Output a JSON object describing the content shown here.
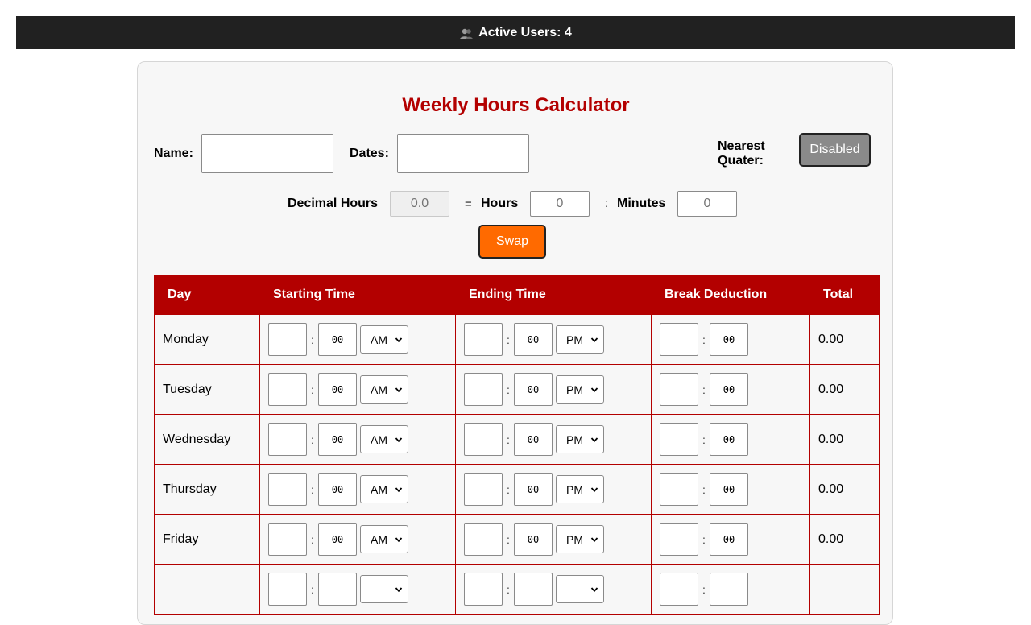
{
  "topbar": {
    "icon": "users-icon",
    "active_users_text": "Active Users: 4"
  },
  "calculator": {
    "title": "Weekly Hours Calculator",
    "name_label": "Name:",
    "name_value": "",
    "dates_label": "Dates:",
    "dates_value": "",
    "nearest_quarter_label_line1": "Nearest",
    "nearest_quarter_label_line2": "Quater:",
    "nearest_quarter_button": "Disabled",
    "decimal_hours_label": "Decimal Hours",
    "decimal_hours_placeholder": "0.0",
    "equals": "=",
    "hours_label": "Hours",
    "hours_placeholder": "0",
    "colon": ":",
    "minutes_label": "Minutes",
    "minutes_placeholder": "0",
    "swap_button": "Swap"
  },
  "table": {
    "headers": [
      "Day",
      "Starting Time",
      "Ending Time",
      "Break Deduction",
      "Total"
    ],
    "colon": ":",
    "rows": [
      {
        "day": "Monday",
        "start_hour": "",
        "start_min": "00",
        "start_ampm": "AM",
        "end_hour": "",
        "end_min": "00",
        "end_ampm": "PM",
        "break_hour": "",
        "break_min": "00",
        "total": "0.00"
      },
      {
        "day": "Tuesday",
        "start_hour": "",
        "start_min": "00",
        "start_ampm": "AM",
        "end_hour": "",
        "end_min": "00",
        "end_ampm": "PM",
        "break_hour": "",
        "break_min": "00",
        "total": "0.00"
      },
      {
        "day": "Wednesday",
        "start_hour": "",
        "start_min": "00",
        "start_ampm": "AM",
        "end_hour": "",
        "end_min": "00",
        "end_ampm": "PM",
        "break_hour": "",
        "break_min": "00",
        "total": "0.00"
      },
      {
        "day": "Thursday",
        "start_hour": "",
        "start_min": "00",
        "start_ampm": "AM",
        "end_hour": "",
        "end_min": "00",
        "end_ampm": "PM",
        "break_hour": "",
        "break_min": "00",
        "total": "0.00"
      },
      {
        "day": "Friday",
        "start_hour": "",
        "start_min": "00",
        "start_ampm": "AM",
        "end_hour": "",
        "end_min": "00",
        "end_ampm": "PM",
        "break_hour": "",
        "break_min": "00",
        "total": "0.00"
      },
      {
        "day": "",
        "start_hour": "",
        "start_min": "",
        "start_ampm": "",
        "end_hour": "",
        "end_min": "",
        "end_ampm": "",
        "break_hour": "",
        "break_min": "",
        "total": ""
      }
    ]
  },
  "colors": {
    "topbar_bg": "#212121",
    "accent_red": "#b30000",
    "swap_orange": "#ff6a00",
    "disabled_gray": "#8a8a8a"
  }
}
